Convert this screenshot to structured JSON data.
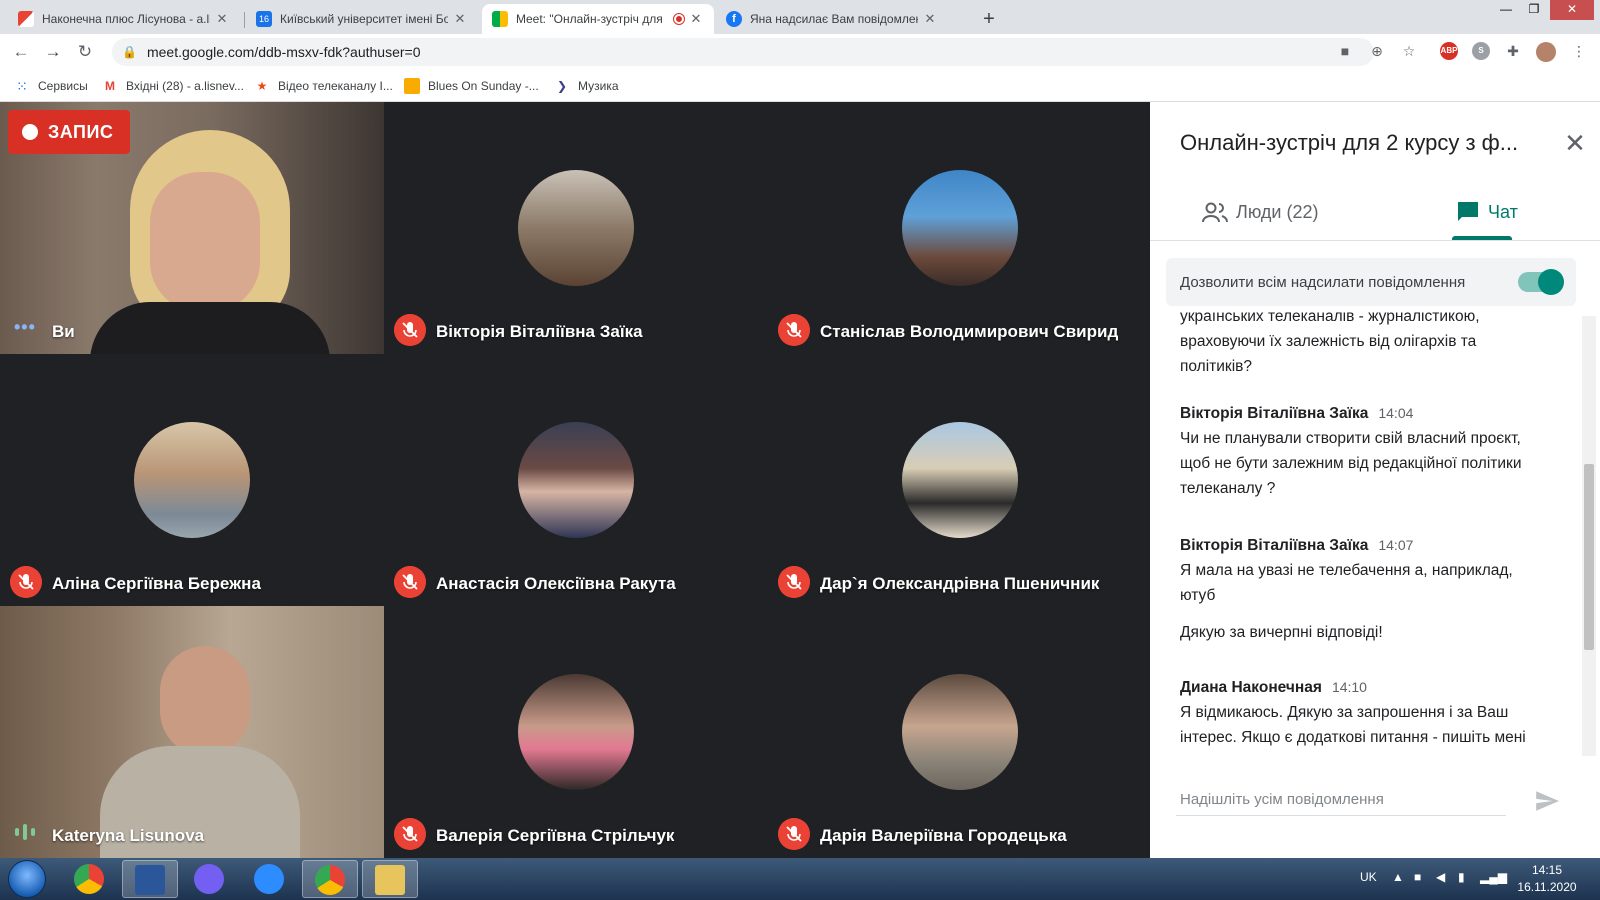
{
  "browser": {
    "tabs": [
      {
        "title": "Наконечна плюс Лісунова - a.lis",
        "favicon": "gmail-icon"
      },
      {
        "title": "Київський університет імені Бор",
        "favicon": "calendar-icon"
      },
      {
        "title": "Meet: \"Онлайн-зустріч для",
        "favicon": "meet-icon"
      },
      {
        "title": "Яна надсилає Вам повідомлення",
        "favicon": "facebook-icon"
      }
    ],
    "url": "meet.google.com/ddb-msxv-fdk?authuser=0",
    "bookmarks": [
      "Сервисы",
      "Вхідні (28) - a.lisnev...",
      "Відео телеканалу І...",
      "Blues On Sunday -...",
      "Музика"
    ]
  },
  "meet": {
    "recording_label": "ЗАПИС",
    "participants": [
      {
        "name": "Ви",
        "type": "video-self"
      },
      {
        "name": "Вікторія Віталіївна Заїка",
        "type": "avatar"
      },
      {
        "name": "Станіслав Володимирович Свирид",
        "type": "avatar"
      },
      {
        "name": "Аліна Сергіївна Бережна",
        "type": "avatar"
      },
      {
        "name": "Анастасія Олексіївна Ракута",
        "type": "avatar"
      },
      {
        "name": "Дар`я Олександрівна Пшеничник",
        "type": "avatar"
      },
      {
        "name": "Kateryna Lisunova",
        "type": "video"
      },
      {
        "name": "Валерія Сергіївна Стрільчук",
        "type": "avatar"
      },
      {
        "name": "Дарія Валеріївна Городецька",
        "type": "avatar"
      }
    ]
  },
  "panel": {
    "title": "Онлайн-зустріч для 2 курсу з ф...",
    "tab_people": "Люди (22)",
    "tab_chat": "Чат",
    "allow_messages": "Дозволити всім надсилати повідомлення",
    "messages": {
      "m0_l1": "українських телеканалів - журналістикою,",
      "m0_l2": "враховуючи їх залежність від олігархів та",
      "m0_l3": "політиків?",
      "m1_sender": "Вікторія Віталіївна Заїка",
      "m1_time": "14:04",
      "m1_l1": "Чи не планували створити свій власний проєкт,",
      "m1_l2": "щоб не бути залежним від редакційної політики",
      "m1_l3": "телеканалу ?",
      "m2_sender": "Вікторія Віталіївна Заїка",
      "m2_time": "14:07",
      "m2_l1": "Я мала на увазі не телебачення а, наприклад,",
      "m2_l2": "ютуб",
      "m2_l3": "Дякую за вичерпні відповіді!",
      "m3_sender": "Диана Наконечная",
      "m3_time": "14:10",
      "m3_l1": "Я відмикаюсь. Дякую за запрошення і за Ваш",
      "m3_l2": "інтерес. Якщо є додаткові питання - пишіть мені"
    },
    "compose_placeholder": "Надішліть усім повідомлення"
  },
  "taskbar": {
    "lang": "UK",
    "time": "14:15",
    "date": "16.11.2020"
  },
  "colors": {
    "meet_bg": "#202124",
    "mic_off": "#ea4335",
    "accent": "#00796b",
    "record": "#d93025"
  }
}
